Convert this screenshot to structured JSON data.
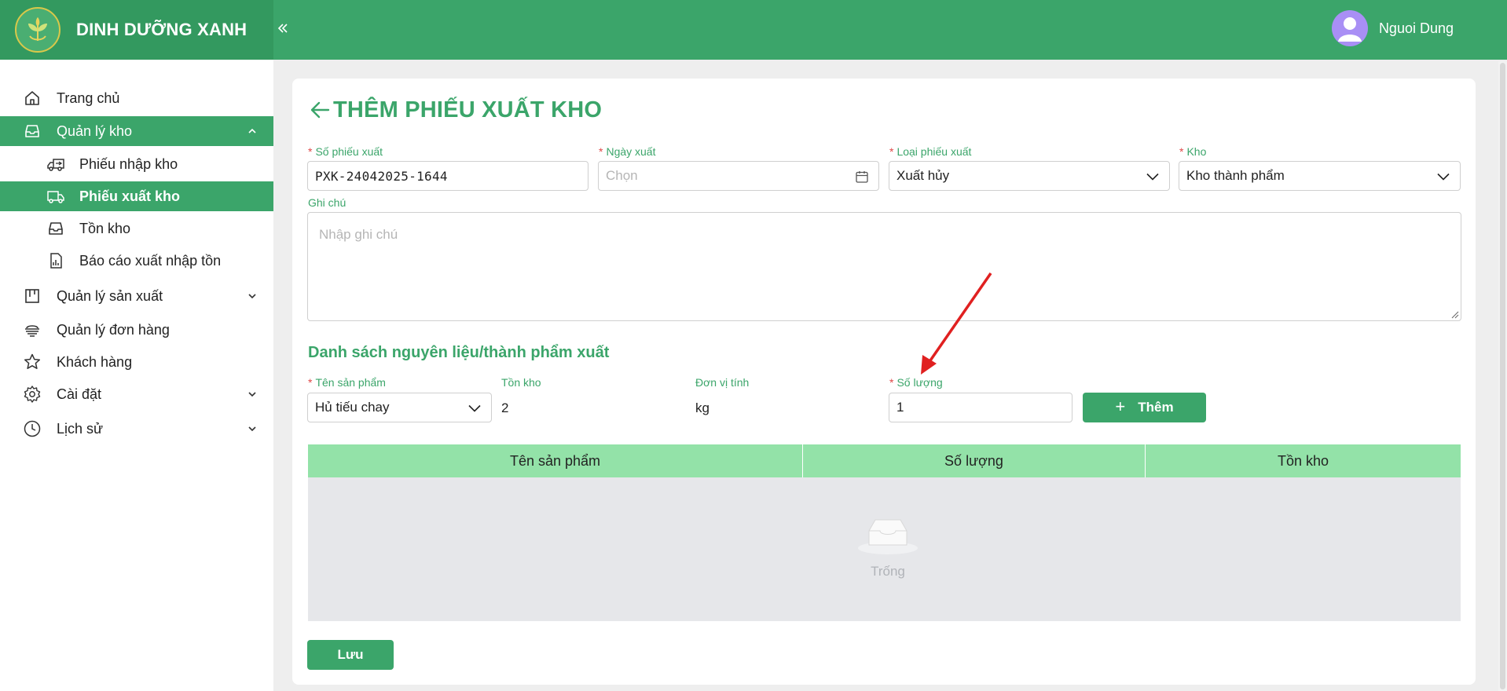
{
  "header": {
    "brand_name": "DINH DƯỠNG XANH",
    "user_name": "Nguoi Dung",
    "brand_color": "#3ba56a"
  },
  "sidebar": {
    "items": [
      {
        "label": "Trang chủ",
        "icon": "home-icon"
      },
      {
        "label": "Quản lý kho",
        "icon": "inbox-icon",
        "expanded": true
      },
      {
        "label": "Phiếu nhập kho",
        "icon": "truck-import-icon"
      },
      {
        "label": "Phiếu xuất kho",
        "icon": "truck-export-icon",
        "active": true
      },
      {
        "label": "Tồn kho",
        "icon": "inbox-icon"
      },
      {
        "label": "Báo cáo xuất nhập tồn",
        "icon": "report-icon"
      },
      {
        "label": "Quản lý sản xuất",
        "icon": "factory-icon"
      },
      {
        "label": "Quản lý đơn hàng",
        "icon": "order-icon"
      },
      {
        "label": "Khách hàng",
        "icon": "star-icon"
      },
      {
        "label": "Cài đặt",
        "icon": "gear-icon"
      },
      {
        "label": "Lịch sử",
        "icon": "history-icon"
      }
    ]
  },
  "page": {
    "title": "THÊM PHIẾU XUẤT KHO",
    "fields": {
      "so_phieu": {
        "label": "Số phiếu xuất",
        "value": "PXK-24042025-1644"
      },
      "ngay_xuat": {
        "label": "Ngày xuất",
        "placeholder": "Chọn"
      },
      "loai_phieu": {
        "label": "Loại phiếu xuất",
        "value": "Xuất hủy"
      },
      "kho": {
        "label": "Kho",
        "value": "Kho thành phẩm"
      },
      "ghi_chu": {
        "label": "Ghi chú",
        "placeholder": "Nhập ghi chú"
      }
    },
    "section_title": "Danh sách nguyên liệu/thành phẩm xuất",
    "item_form": {
      "ten_san_pham": {
        "label": "Tên sản phẩm",
        "value": "Hủ tiếu chay"
      },
      "ton_kho": {
        "label": "Tồn kho",
        "value": "2"
      },
      "don_vi_tinh": {
        "label": "Đơn vị tính",
        "value": "kg"
      },
      "so_luong": {
        "label": "Số lượng",
        "value": "1"
      },
      "add_button": "Thêm"
    },
    "table": {
      "columns": [
        "Tên sản phẩm",
        "Số lượng",
        "Tồn kho"
      ],
      "empty_text": "Trống"
    },
    "save_button": "Lưu"
  }
}
